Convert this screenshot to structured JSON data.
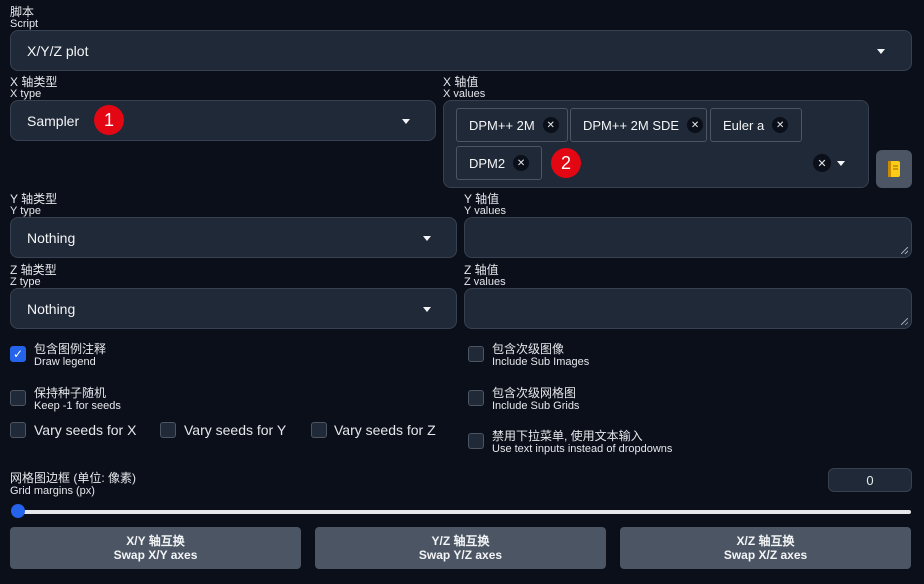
{
  "script": {
    "label_cn": "脚本",
    "label_en": "Script",
    "value": "X/Y/Z plot"
  },
  "x_type": {
    "label_cn": "X 轴类型",
    "label_en": "X type",
    "value": "Sampler",
    "badge": "1"
  },
  "x_values": {
    "label_cn": "X 轴值",
    "label_en": "X values",
    "tags": [
      "DPM++ 2M",
      "DPM++ 2M SDE",
      "Euler a",
      "DPM2"
    ],
    "badge": "2",
    "remove_icon": "close-icon",
    "clear_icon": "clear-icon",
    "book_icon": "notebook-icon"
  },
  "y_type": {
    "label_cn": "Y 轴类型",
    "label_en": "Y type",
    "value": "Nothing"
  },
  "y_values": {
    "label_cn": "Y 轴值",
    "label_en": "Y values"
  },
  "z_type": {
    "label_cn": "Z 轴类型",
    "label_en": "Z type",
    "value": "Nothing"
  },
  "z_values": {
    "label_cn": "Z 轴值",
    "label_en": "Z values"
  },
  "checkboxes": {
    "draw_legend": {
      "cn": "包含图例注释",
      "en": "Draw legend",
      "checked": true
    },
    "keep_seeds": {
      "cn": "保持种子随机",
      "en": "Keep -1 for seeds",
      "checked": false
    },
    "vary_x": {
      "label": "Vary seeds for X",
      "checked": false
    },
    "vary_y": {
      "label": "Vary seeds for Y",
      "checked": false
    },
    "vary_z": {
      "label": "Vary seeds for Z",
      "checked": false
    },
    "include_sub_images": {
      "cn": "包含次级图像",
      "en": "Include Sub Images",
      "checked": false
    },
    "include_sub_grids": {
      "cn": "包含次级网格图",
      "en": "Include Sub Grids",
      "checked": false
    },
    "text_inputs": {
      "cn": "禁用下拉菜单, 使用文本输入",
      "en": "Use text inputs instead of dropdowns",
      "checked": false
    }
  },
  "grid_margins": {
    "label_cn": "网格图边框 (单位: 像素)",
    "label_en": "Grid margins (px)",
    "value": "0",
    "slider_fraction": 0
  },
  "buttons": {
    "swap_xy": {
      "cn": "X/Y 轴互换",
      "en": "Swap X/Y axes"
    },
    "swap_yz": {
      "cn": "Y/Z 轴互换",
      "en": "Swap Y/Z axes"
    },
    "swap_xz": {
      "cn": "X/Z 轴互换",
      "en": "Swap X/Z axes"
    }
  },
  "colors": {
    "background": "#0b0f19",
    "panel": "#1f2937",
    "accent": "#2563eb",
    "badge": "#e30613"
  }
}
